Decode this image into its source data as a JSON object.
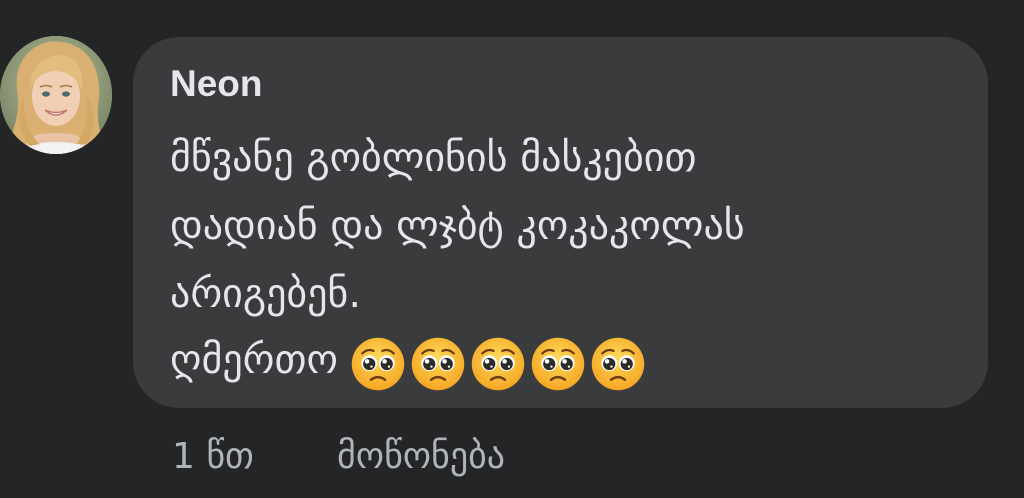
{
  "comment": {
    "author": "Neon",
    "text_lines": [
      "მწვანე გობლინის მასკებით",
      "დადიან და ლჯბტ კოკაკოლას",
      "არიგებენ.",
      "ღმერთო"
    ],
    "emoji_name": "pleading-face-icon",
    "emoji_count": 5,
    "time": "1 წთ",
    "like_label": "მოწონება"
  },
  "colors": {
    "background": "#242526",
    "bubble": "#3a3b3c",
    "text": "#e4e6eb",
    "meta_text": "#b0b3b8"
  }
}
